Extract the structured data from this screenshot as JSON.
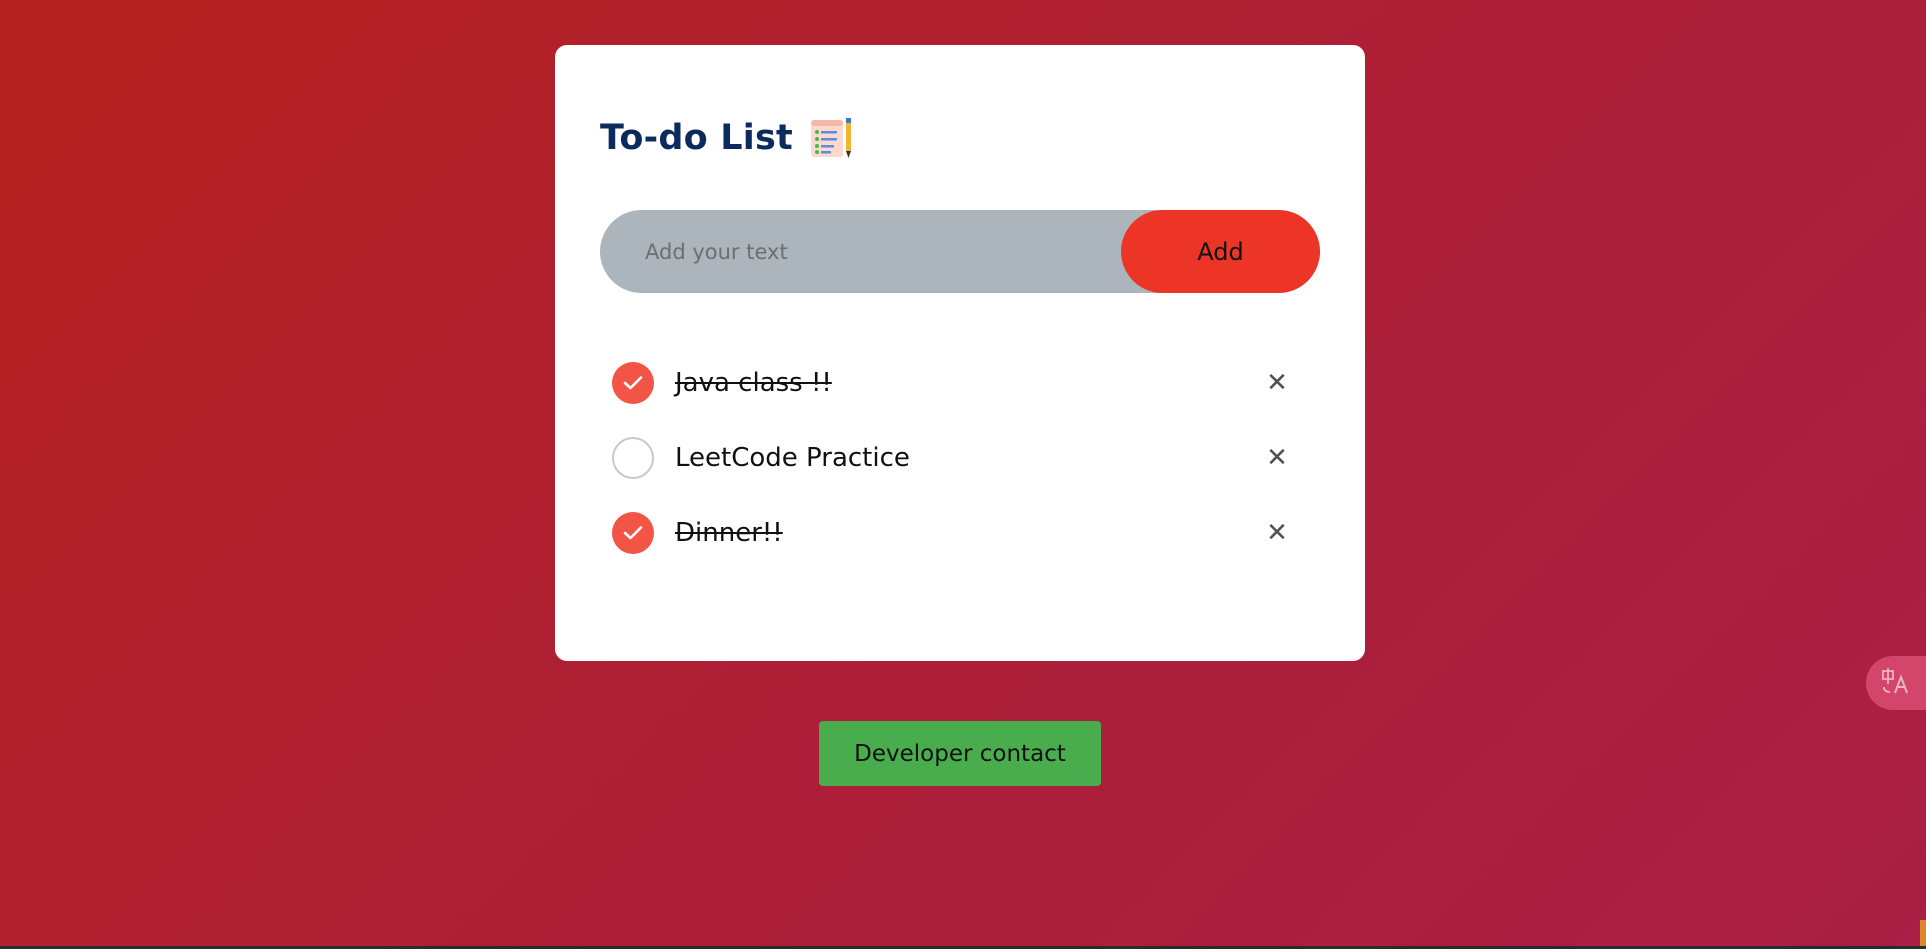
{
  "app": {
    "title": "To-do List",
    "title_icon": "notepad-checklist-icon"
  },
  "input": {
    "placeholder": "Add your text",
    "value": ""
  },
  "add_button": {
    "label": "Add"
  },
  "todos": [
    {
      "text": "Java class !!",
      "done": true
    },
    {
      "text": "LeetCode Practice",
      "done": false
    },
    {
      "text": "Dinner!!",
      "done": true
    }
  ],
  "icons": {
    "checked": "check-icon",
    "delete": "close-icon",
    "translate": "translate-icon"
  },
  "delete_glyph": "✕",
  "contact_button": {
    "label": "Developer contact"
  },
  "colors": {
    "background_start": "#b5221f",
    "background_end": "#a91f45",
    "title": "#0c2a5e",
    "accent": "#ec3527",
    "check": "#f25445",
    "input_bg": "#adb5bc",
    "contact_button": "#4aad4d"
  }
}
